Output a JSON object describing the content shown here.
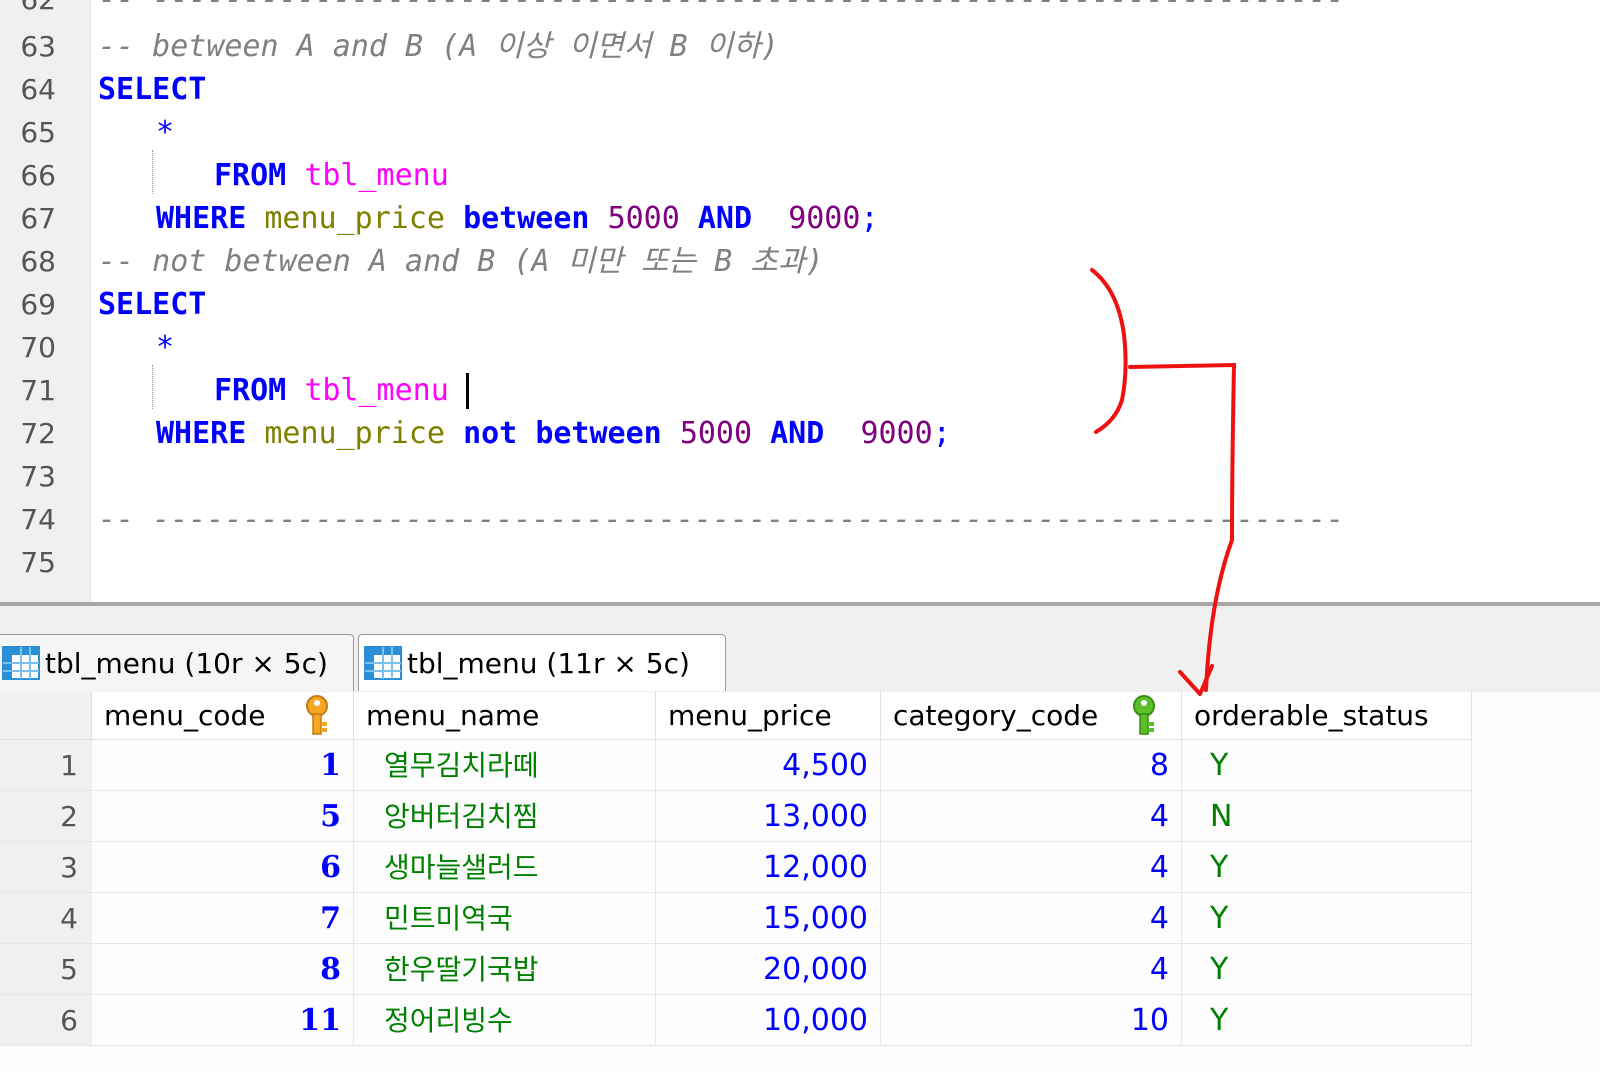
{
  "editor": {
    "lines": [
      {
        "n": "62"
      },
      {
        "n": "63",
        "comment": "-- between A and B (A 이상 이면서 B 이하)"
      },
      {
        "n": "64",
        "select": "SELECT"
      },
      {
        "n": "65",
        "star": "*"
      },
      {
        "n": "66",
        "from": "FROM",
        "table": "tbl_menu"
      },
      {
        "n": "67",
        "where": "WHERE",
        "col": "menu_price",
        "op": "between",
        "v1": "5000",
        "and": "AND",
        "v2": "9000",
        "end": ";"
      },
      {
        "n": "68",
        "comment": "-- not between A and B (A 미만 또는 B 초과)"
      },
      {
        "n": "69",
        "select": "SELECT"
      },
      {
        "n": "70",
        "star": "*"
      },
      {
        "n": "71",
        "from": "FROM",
        "table": "tbl_menu"
      },
      {
        "n": "72",
        "where": "WHERE",
        "col": "menu_price",
        "not": "not",
        "op": "between",
        "v1": "5000",
        "and": "AND",
        "v2": "9000",
        "end": ";"
      },
      {
        "n": "73"
      },
      {
        "n": "74",
        "comment": "-- ------------------------------------------------------------------"
      },
      {
        "n": "75"
      }
    ],
    "top_divider": "-- ------------------------------------------------------------------"
  },
  "tabs": [
    {
      "label": "tbl_menu (10r × 5c)",
      "icon": "table-grid-icon"
    },
    {
      "label": "tbl_menu (11r × 5c)",
      "icon": "table-grid-icon",
      "active": true
    }
  ],
  "grid": {
    "columns": [
      "menu_code",
      "menu_name",
      "menu_price",
      "category_code",
      "orderable_status"
    ],
    "primary_key_color": "#f5a623",
    "foreign_key_color": "#5cbf2a",
    "rows": [
      {
        "row": "1",
        "menu_code": "1",
        "menu_name": "열무김치라떼",
        "menu_price": "4,500",
        "category_code": "8",
        "orderable_status": "Y"
      },
      {
        "row": "2",
        "menu_code": "5",
        "menu_name": "앙버터김치찜",
        "menu_price": "13,000",
        "category_code": "4",
        "orderable_status": "N"
      },
      {
        "row": "3",
        "menu_code": "6",
        "menu_name": "생마늘샐러드",
        "menu_price": "12,000",
        "category_code": "4",
        "orderable_status": "Y"
      },
      {
        "row": "4",
        "menu_code": "7",
        "menu_name": "민트미역국",
        "menu_price": "15,000",
        "category_code": "4",
        "orderable_status": "Y"
      },
      {
        "row": "5",
        "menu_code": "8",
        "menu_name": "한우딸기국밥",
        "menu_price": "20,000",
        "category_code": "4",
        "orderable_status": "Y"
      },
      {
        "row": "6",
        "menu_code": "11",
        "menu_name": "정어리빙수",
        "menu_price": "10,000",
        "category_code": "10",
        "orderable_status": "Y"
      }
    ]
  },
  "annotation_color": "#ee1111"
}
